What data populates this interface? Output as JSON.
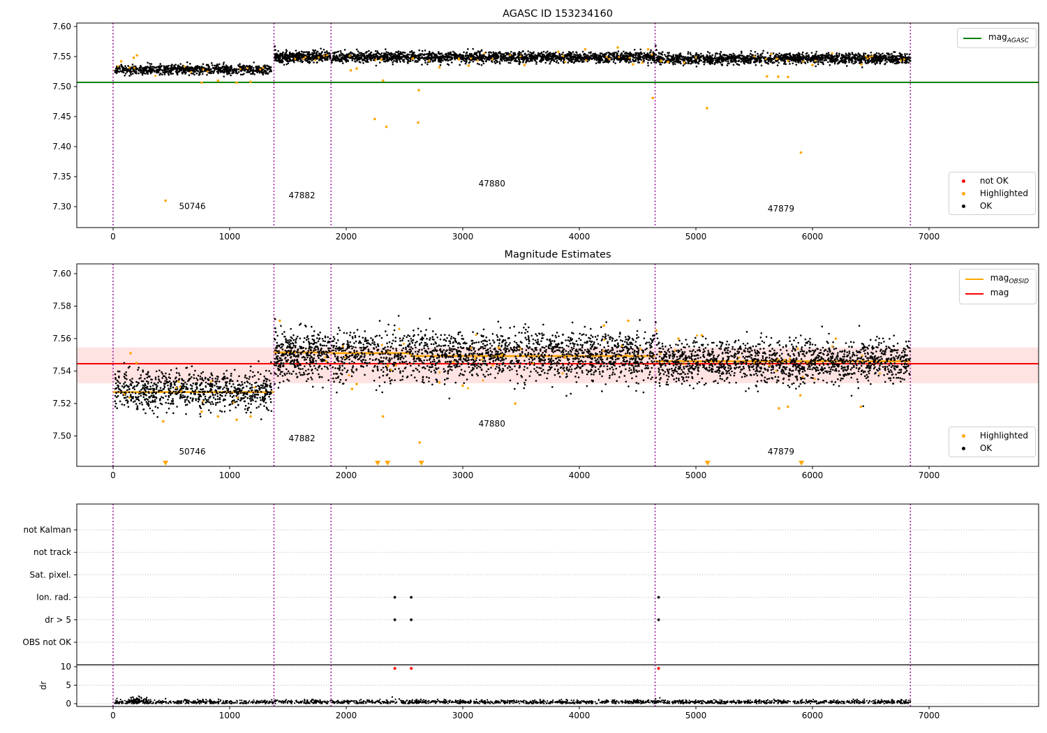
{
  "figure_titles": {
    "top": "AGASC ID 153234160",
    "middle": "Magnitude Estimates"
  },
  "colors": {
    "ok_black": "#000000",
    "highlighted_orange": "#ffa500",
    "not_ok_red": "#ff0000",
    "mag_agasc_green": "#008000",
    "mag_red": "#ff0000",
    "mag_obsid_orange": "#ffa500",
    "obsid_vline_purple": "#960096",
    "band_pink": "rgba(255,60,60,0.15)",
    "grid_gray": "#b0b0b0"
  },
  "chart_data": [
    {
      "id": "top",
      "type": "scatter",
      "title": "AGASC ID 153234160",
      "xlim": [
        -311,
        7940
      ],
      "ylim": [
        7.265,
        7.606
      ],
      "xticks": [
        0,
        1000,
        2000,
        3000,
        4000,
        5000,
        6000,
        7000
      ],
      "yticks": [
        7.3,
        7.35,
        7.4,
        7.45,
        7.5,
        7.55,
        7.6
      ],
      "hline": {
        "label": "mag",
        "label_sub": "AGASC",
        "y": 7.507,
        "color": "#008000"
      },
      "vlines": [
        0,
        1380,
        1870,
        4650,
        6840
      ],
      "obsid_labels": [
        {
          "text": "50746",
          "x": 680,
          "y": 7.296
        },
        {
          "text": "47882",
          "x": 1620,
          "y": 7.314
        },
        {
          "text": "47880",
          "x": 3250,
          "y": 7.334
        },
        {
          "text": "47879",
          "x": 5730,
          "y": 7.292
        }
      ],
      "segments": [
        {
          "x0": 15,
          "x1": 1360,
          "n": 850,
          "mean": 7.5285,
          "sigma": 0.004,
          "seed": 11
        },
        {
          "x0": 1385,
          "x1": 1865,
          "n": 420,
          "mean": 7.5495,
          "sigma": 0.0045,
          "seed": 22
        },
        {
          "x0": 1875,
          "x1": 4645,
          "n": 1900,
          "mean": 7.549,
          "sigma": 0.0045,
          "seed": 33
        },
        {
          "x0": 4655,
          "x1": 6840,
          "n": 1500,
          "mean": 7.5465,
          "sigma": 0.0045,
          "seed": 44
        }
      ],
      "orange_fraction": 0.012,
      "extra_black_points": [
        [
          1388,
          7.567
        ],
        [
          1392,
          7.561
        ],
        [
          4655,
          7.568
        ],
        [
          4662,
          7.561
        ]
      ],
      "highlighted_outliers": [
        [
          70,
          7.542
        ],
        [
          177,
          7.548
        ],
        [
          205,
          7.552
        ],
        [
          450,
          7.31
        ],
        [
          760,
          7.5065
        ],
        [
          900,
          7.51
        ],
        [
          1060,
          7.5065
        ],
        [
          1180,
          7.508
        ],
        [
          2040,
          7.527
        ],
        [
          2090,
          7.53
        ],
        [
          2300,
          7.545
        ],
        [
          2316,
          7.51
        ],
        [
          2245,
          7.446
        ],
        [
          2345,
          7.433
        ],
        [
          2617,
          7.44
        ],
        [
          2623,
          7.494
        ],
        [
          2800,
          7.532
        ],
        [
          3050,
          7.535
        ],
        [
          3530,
          7.536
        ],
        [
          3820,
          7.558
        ],
        [
          4050,
          7.562
        ],
        [
          4330,
          7.565
        ],
        [
          4460,
          7.537
        ],
        [
          4540,
          7.54
        ],
        [
          4590,
          7.562
        ],
        [
          4630,
          7.481
        ],
        [
          4700,
          7.543
        ],
        [
          4760,
          7.541
        ],
        [
          4900,
          7.54
        ],
        [
          5095,
          7.464
        ],
        [
          5610,
          7.517
        ],
        [
          5706,
          7.5165
        ],
        [
          5790,
          7.516
        ],
        [
          5901,
          7.39
        ],
        [
          6000,
          7.536
        ],
        [
          6420,
          7.537
        ]
      ],
      "legend_line": [
        {
          "label": "mag",
          "sub": "AGASC",
          "color": "#008000"
        }
      ],
      "legend_markers": [
        {
          "label": "not OK",
          "color": "#ff0000"
        },
        {
          "label": "Highlighted",
          "color": "#ffa500"
        },
        {
          "label": "OK",
          "color": "#000000"
        }
      ]
    },
    {
      "id": "middle",
      "type": "scatter",
      "title": "Magnitude Estimates",
      "xlim": [
        -311,
        7940
      ],
      "ylim": [
        7.481,
        7.606
      ],
      "xticks": [
        0,
        1000,
        2000,
        3000,
        4000,
        5000,
        6000,
        7000
      ],
      "yticks": [
        7.5,
        7.52,
        7.54,
        7.56,
        7.58,
        7.6
      ],
      "mag_line": {
        "label": "mag",
        "y": 7.5445,
        "color": "#ff0000"
      },
      "mag_band": {
        "y0": 7.5325,
        "y1": 7.5545
      },
      "obsid_line_label": {
        "label": "mag",
        "sub": "OBSID",
        "color": "#ffa500"
      },
      "obsid_line_segments": [
        {
          "x0": 0,
          "x1": 1380,
          "y": 7.527
        },
        {
          "x0": 1380,
          "x1": 1870,
          "y": 7.5515
        },
        {
          "x0": 1870,
          "x1": 2550,
          "y": 7.551
        },
        {
          "x0": 2550,
          "x1": 4650,
          "y": 7.5492
        },
        {
          "x0": 4650,
          "x1": 6840,
          "y": 7.546
        }
      ],
      "vlines": [
        0,
        1380,
        1870,
        4650,
        6840
      ],
      "obsid_labels": [
        {
          "text": "50746",
          "x": 680,
          "y": 7.4885
        },
        {
          "text": "47882",
          "x": 1620,
          "y": 7.4968
        },
        {
          "text": "47880",
          "x": 3250,
          "y": 7.5058
        },
        {
          "text": "47879",
          "x": 5730,
          "y": 7.4885
        }
      ],
      "segments": [
        {
          "x0": 15,
          "x1": 1360,
          "n": 850,
          "mean": 7.528,
          "sigma": 0.0062,
          "seed": 55
        },
        {
          "x0": 1385,
          "x1": 1865,
          "n": 420,
          "mean": 7.55,
          "sigma": 0.0075,
          "seed": 66
        },
        {
          "x0": 1875,
          "x1": 4645,
          "n": 1900,
          "mean": 7.5495,
          "sigma": 0.0075,
          "seed": 77
        },
        {
          "x0": 4655,
          "x1": 6840,
          "n": 1500,
          "mean": 7.546,
          "sigma": 0.0065,
          "seed": 88
        }
      ],
      "orange_fraction": 0.012,
      "extra_black_points": [
        [
          1390,
          7.572
        ],
        [
          1396,
          7.564
        ],
        [
          4655,
          7.57
        ],
        [
          4663,
          7.563
        ]
      ],
      "highlighted_outliers": [
        [
          150,
          7.551
        ],
        [
          200,
          7.545
        ],
        [
          430,
          7.509
        ],
        [
          760,
          7.515
        ],
        [
          900,
          7.512
        ],
        [
          1060,
          7.51
        ],
        [
          1180,
          7.512
        ],
        [
          1430,
          7.571
        ],
        [
          2050,
          7.529
        ],
        [
          2090,
          7.532
        ],
        [
          2315,
          7.512
        ],
        [
          2630,
          7.496
        ],
        [
          2800,
          7.533
        ],
        [
          3000,
          7.531
        ],
        [
          3450,
          7.52
        ],
        [
          4210,
          7.568
        ],
        [
          4420,
          7.571
        ],
        [
          4660,
          7.565
        ],
        [
          4850,
          7.56
        ],
        [
          5050,
          7.562
        ],
        [
          5712,
          7.517
        ],
        [
          5789,
          7.518
        ],
        [
          5896,
          7.525
        ],
        [
          6200,
          7.56
        ],
        [
          6415,
          7.518
        ]
      ],
      "clipped_low_markers_x": [
        450,
        2270,
        2355,
        2645,
        5100,
        5905
      ],
      "legend_lines": [
        {
          "label": "mag",
          "sub": "OBSID",
          "color": "#ffa500"
        },
        {
          "label": "mag",
          "sub": "",
          "color": "#ff0000"
        }
      ],
      "legend_markers": [
        {
          "label": "Highlighted",
          "color": "#ffa500"
        },
        {
          "label": "OK",
          "color": "#000000"
        }
      ]
    },
    {
      "id": "flags",
      "type": "scatter",
      "xlim": [
        -311,
        7940
      ],
      "xticks": [
        0,
        1000,
        2000,
        3000,
        4000,
        5000,
        6000,
        7000
      ],
      "categories": [
        "not Kalman",
        "not track",
        "Sat. pixel.",
        "Ion. rad.",
        "dr > 5",
        "OBS not OK"
      ],
      "dr_axis": {
        "label": "dr",
        "ticks": [
          0,
          5,
          10
        ],
        "separator_y": 10.5
      },
      "vlines": [
        0,
        1380,
        1870,
        4650,
        6840
      ],
      "flag_points": [
        {
          "category": "Ion. rad.",
          "x": [
            2417,
            2558,
            4680
          ]
        },
        {
          "category": "dr > 5",
          "x": [
            2417,
            2558,
            4680
          ]
        }
      ],
      "dr_over_limit_points": {
        "x": [
          2417,
          2558,
          4680
        ],
        "value": 10,
        "color": "#ff0000"
      },
      "dr_segments": [
        {
          "x0": 15,
          "x1": 6840,
          "n": 1900,
          "mean": 0.45,
          "sigma": 0.28,
          "seed": 99
        },
        {
          "x0": 130,
          "x1": 290,
          "n": 70,
          "mean": 0.95,
          "sigma": 0.45,
          "seed": 111
        }
      ],
      "dr_extra_points": [
        [
          450,
          1.35
        ],
        [
          770,
          1.15
        ],
        [
          905,
          1.2
        ],
        [
          2395,
          1.8
        ],
        [
          2455,
          1.25
        ],
        [
          2520,
          0.9
        ]
      ]
    }
  ]
}
